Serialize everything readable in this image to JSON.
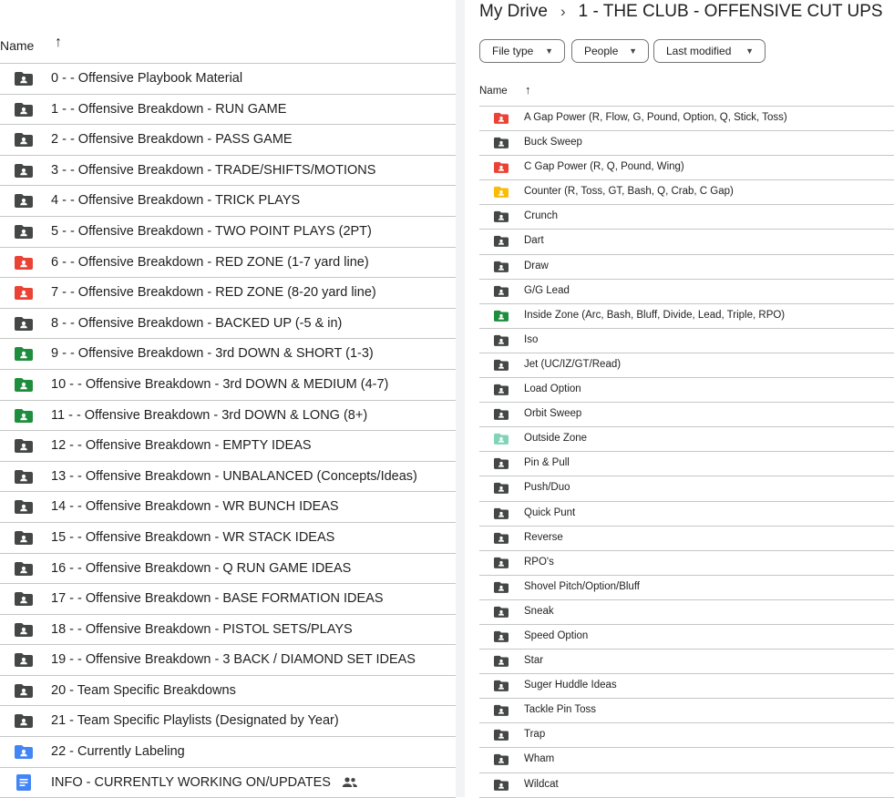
{
  "left_panel": {
    "header": {
      "name_label": "Name",
      "sort_icon": "arrow-up-icon"
    },
    "items": [
      {
        "label": "0 - - Offensive Playbook Material",
        "icon": "shared-folder-icon",
        "color": "#444746"
      },
      {
        "label": "1 - - Offensive Breakdown - RUN GAME",
        "icon": "shared-folder-icon",
        "color": "#444746"
      },
      {
        "label": "2 - - Offensive Breakdown - PASS GAME",
        "icon": "shared-folder-icon",
        "color": "#444746"
      },
      {
        "label": "3 - - Offensive Breakdown - TRADE/SHIFTS/MOTIONS",
        "icon": "shared-folder-icon",
        "color": "#444746"
      },
      {
        "label": "4 - - Offensive Breakdown - TRICK PLAYS",
        "icon": "shared-folder-icon",
        "color": "#444746"
      },
      {
        "label": "5 - - Offensive Breakdown - TWO POINT PLAYS (2PT)",
        "icon": "shared-folder-icon",
        "color": "#444746"
      },
      {
        "label": "6 - - Offensive Breakdown - RED ZONE (1-7 yard line)",
        "icon": "shared-folder-icon",
        "color": "#ea4335"
      },
      {
        "label": "7 - - Offensive Breakdown - RED ZONE (8-20 yard line)",
        "icon": "shared-folder-icon",
        "color": "#ea4335"
      },
      {
        "label": "8 - - Offensive Breakdown - BACKED UP (-5 & in)",
        "icon": "shared-folder-icon",
        "color": "#444746"
      },
      {
        "label": "9 - - Offensive Breakdown - 3rd DOWN & SHORT (1-3)",
        "icon": "shared-folder-icon",
        "color": "#1e8e3e"
      },
      {
        "label": "10 - - Offensive Breakdown - 3rd DOWN & MEDIUM (4-7)",
        "icon": "shared-folder-icon",
        "color": "#1e8e3e"
      },
      {
        "label": "11 - - Offensive Breakdown - 3rd DOWN & LONG (8+)",
        "icon": "shared-folder-icon",
        "color": "#1e8e3e"
      },
      {
        "label": "12 - - Offensive Breakdown - EMPTY IDEAS",
        "icon": "shared-folder-icon",
        "color": "#444746"
      },
      {
        "label": "13 - - Offensive Breakdown - UNBALANCED (Concepts/Ideas)",
        "icon": "shared-folder-icon",
        "color": "#444746"
      },
      {
        "label": "14 - - Offensive Breakdown - WR BUNCH IDEAS",
        "icon": "shared-folder-icon",
        "color": "#444746"
      },
      {
        "label": "15 - - Offensive Breakdown - WR STACK IDEAS",
        "icon": "shared-folder-icon",
        "color": "#444746"
      },
      {
        "label": "16 - - Offensive Breakdown - Q RUN GAME IDEAS",
        "icon": "shared-folder-icon",
        "color": "#444746"
      },
      {
        "label": "17 - - Offensive Breakdown - BASE FORMATION IDEAS",
        "icon": "shared-folder-icon",
        "color": "#444746"
      },
      {
        "label": "18 - - Offensive Breakdown - PISTOL SETS/PLAYS",
        "icon": "shared-folder-icon",
        "color": "#444746"
      },
      {
        "label": "19 - - Offensive Breakdown - 3 BACK / DIAMOND SET IDEAS",
        "icon": "shared-folder-icon",
        "color": "#444746"
      },
      {
        "label": "20 - Team Specific Breakdowns",
        "icon": "shared-folder-icon",
        "color": "#444746"
      },
      {
        "label": "21 - Team Specific Playlists (Designated by Year)",
        "icon": "shared-folder-icon",
        "color": "#444746"
      },
      {
        "label": "22 - Currently Labeling",
        "icon": "shared-folder-icon",
        "color": "#4285f4"
      },
      {
        "label": "INFO - CURRENTLY WORKING ON/UPDATES",
        "icon": "google-doc-icon",
        "color": "#4285f4",
        "shared": true
      }
    ]
  },
  "right_panel": {
    "breadcrumb": {
      "root": "My Drive",
      "separator": "›",
      "current": "1 - THE CLUB - OFFENSIVE CUT UPS"
    },
    "filters": [
      {
        "label": "File type"
      },
      {
        "label": "People"
      },
      {
        "label": "Last modified"
      }
    ],
    "header": {
      "name_label": "Name",
      "sort_icon": "arrow-up-icon"
    },
    "items": [
      {
        "label": "A Gap Power (R, Flow, G, Pound, Option, Q, Stick, Toss)",
        "color": "#ea4335"
      },
      {
        "label": "Buck Sweep",
        "color": "#444746"
      },
      {
        "label": "C Gap Power (R, Q, Pound, Wing)",
        "color": "#ea4335"
      },
      {
        "label": "Counter (R, Toss, GT, Bash, Q, Crab, C Gap)",
        "color": "#fbbc04"
      },
      {
        "label": "Crunch",
        "color": "#444746"
      },
      {
        "label": "Dart",
        "color": "#444746"
      },
      {
        "label": "Draw",
        "color": "#444746"
      },
      {
        "label": "G/G Lead",
        "color": "#444746"
      },
      {
        "label": "Inside Zone (Arc, Bash, Bluff, Divide, Lead, Triple, RPO)",
        "color": "#1e8e3e"
      },
      {
        "label": "Iso",
        "color": "#444746"
      },
      {
        "label": "Jet (UC/IZ/GT/Read)",
        "color": "#444746"
      },
      {
        "label": "Load Option",
        "color": "#444746"
      },
      {
        "label": "Orbit Sweep",
        "color": "#444746"
      },
      {
        "label": "Outside Zone",
        "color": "#81d4b8"
      },
      {
        "label": "Pin & Pull",
        "color": "#444746"
      },
      {
        "label": "Push/Duo",
        "color": "#444746"
      },
      {
        "label": "Quick Punt",
        "color": "#444746"
      },
      {
        "label": "Reverse",
        "color": "#444746"
      },
      {
        "label": "RPO's",
        "color": "#444746"
      },
      {
        "label": "Shovel Pitch/Option/Bluff",
        "color": "#444746"
      },
      {
        "label": "Sneak",
        "color": "#444746"
      },
      {
        "label": "Speed Option",
        "color": "#444746"
      },
      {
        "label": "Star",
        "color": "#444746"
      },
      {
        "label": "Suger Huddle Ideas",
        "color": "#444746"
      },
      {
        "label": "Tackle Pin Toss",
        "color": "#444746"
      },
      {
        "label": "Trap",
        "color": "#444746"
      },
      {
        "label": "Wham",
        "color": "#444746"
      },
      {
        "label": "Wildcat",
        "color": "#444746"
      }
    ]
  }
}
